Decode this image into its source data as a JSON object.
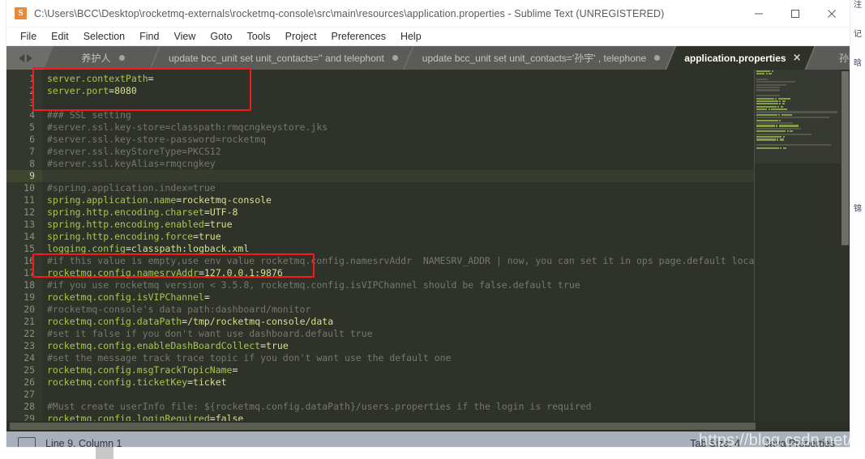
{
  "window": {
    "title": "C:\\Users\\BCC\\Desktop\\rocketmq-externals\\rocketmq-console\\src\\main\\resources\\application.properties - Sublime Text (UNREGISTERED)",
    "app_icon_glyph": "S",
    "controls": {
      "minimize": "minimize-icon",
      "maximize": "maximize-icon",
      "close": "close-icon"
    }
  },
  "menubar": {
    "items": [
      {
        "label": "File"
      },
      {
        "label": "Edit"
      },
      {
        "label": "Selection"
      },
      {
        "label": "Find"
      },
      {
        "label": "View"
      },
      {
        "label": "Goto"
      },
      {
        "label": "Tools"
      },
      {
        "label": "Project"
      },
      {
        "label": "Preferences"
      },
      {
        "label": "Help"
      }
    ]
  },
  "tabs": {
    "items": [
      {
        "label": "养护人",
        "active": false,
        "dirty": true
      },
      {
        "label": "update bcc_unit set unit_contacts='' and telephont",
        "active": false,
        "dirty": true
      },
      {
        "label": "update bcc_unit set unit_contacts='孙宇' , telephone",
        "active": false,
        "dirty": true
      },
      {
        "label": "application.properties",
        "active": true,
        "dirty": false
      },
      {
        "label": "孙宇",
        "active": false,
        "dirty": true
      }
    ],
    "close_glyph": "×",
    "dropdown": "tab-overflow-caret-icon"
  },
  "editor": {
    "current_line": 9,
    "lines": [
      {
        "n": 1,
        "tokens": [
          {
            "t": "server.contextPath",
            "c": "k"
          },
          {
            "t": "=",
            "c": "op"
          }
        ]
      },
      {
        "n": 2,
        "tokens": [
          {
            "t": "server.port",
            "c": "k"
          },
          {
            "t": "=",
            "c": "op"
          },
          {
            "t": "8080",
            "c": "v"
          }
        ]
      },
      {
        "n": 3,
        "tokens": []
      },
      {
        "n": 4,
        "tokens": [
          {
            "t": "### SSL setting",
            "c": "cm"
          }
        ]
      },
      {
        "n": 5,
        "tokens": [
          {
            "t": "#server.ssl.key-store=classpath:rmqcngkeystore.jks",
            "c": "cm"
          }
        ]
      },
      {
        "n": 6,
        "tokens": [
          {
            "t": "#server.ssl.key-store-password=rocketmq",
            "c": "cm"
          }
        ]
      },
      {
        "n": 7,
        "tokens": [
          {
            "t": "#server.ssl.keyStoreType=PKCS12",
            "c": "cm"
          }
        ]
      },
      {
        "n": 8,
        "tokens": [
          {
            "t": "#server.ssl.keyAlias=rmqcngkey",
            "c": "cm"
          }
        ]
      },
      {
        "n": 9,
        "tokens": []
      },
      {
        "n": 10,
        "tokens": [
          {
            "t": "#spring.application.index=true",
            "c": "cm"
          }
        ]
      },
      {
        "n": 11,
        "tokens": [
          {
            "t": "spring.application.name",
            "c": "k"
          },
          {
            "t": "=",
            "c": "op"
          },
          {
            "t": "rocketmq-console",
            "c": "v"
          }
        ]
      },
      {
        "n": 12,
        "tokens": [
          {
            "t": "spring.http.encoding.charset",
            "c": "k"
          },
          {
            "t": "=",
            "c": "op"
          },
          {
            "t": "UTF-8",
            "c": "v"
          }
        ]
      },
      {
        "n": 13,
        "tokens": [
          {
            "t": "spring.http.encoding.enabled",
            "c": "k"
          },
          {
            "t": "=",
            "c": "op"
          },
          {
            "t": "true",
            "c": "v"
          }
        ]
      },
      {
        "n": 14,
        "tokens": [
          {
            "t": "spring.http.encoding.force",
            "c": "k"
          },
          {
            "t": "=",
            "c": "op"
          },
          {
            "t": "true",
            "c": "v"
          }
        ]
      },
      {
        "n": 15,
        "tokens": [
          {
            "t": "logging.config",
            "c": "k"
          },
          {
            "t": "=",
            "c": "op"
          },
          {
            "t": "classpath:logback.xml",
            "c": "v"
          }
        ]
      },
      {
        "n": 16,
        "tokens": [
          {
            "t": "#if this value is empty,use env value rocketmq.config.namesrvAddr  NAMESRV_ADDR | now, you can set it in ops page.default localhost:",
            "c": "cm"
          }
        ]
      },
      {
        "n": 17,
        "tokens": [
          {
            "t": "rocketmq.config.namesrvAddr",
            "c": "k"
          },
          {
            "t": "=",
            "c": "op"
          },
          {
            "t": "127.0.0.1:9876",
            "c": "v"
          }
        ]
      },
      {
        "n": 18,
        "tokens": [
          {
            "t": "#if you use rocketmq version < 3.5.8, rocketmq.config.isVIPChannel should be false.default true",
            "c": "cm"
          }
        ]
      },
      {
        "n": 19,
        "tokens": [
          {
            "t": "rocketmq.config.isVIPChannel",
            "c": "k"
          },
          {
            "t": "=",
            "c": "op"
          }
        ]
      },
      {
        "n": 20,
        "tokens": [
          {
            "t": "#rocketmq-console's data path:dashboard/monitor",
            "c": "cm"
          }
        ]
      },
      {
        "n": 21,
        "tokens": [
          {
            "t": "rocketmq.config.dataPath",
            "c": "k"
          },
          {
            "t": "=",
            "c": "op"
          },
          {
            "t": "/tmp/rocketmq-console/data",
            "c": "v"
          }
        ]
      },
      {
        "n": 22,
        "tokens": [
          {
            "t": "#set it false if you don't want use dashboard.default true",
            "c": "cm"
          }
        ]
      },
      {
        "n": 23,
        "tokens": [
          {
            "t": "rocketmq.config.enableDashBoardCollect",
            "c": "k"
          },
          {
            "t": "=",
            "c": "op"
          },
          {
            "t": "true",
            "c": "v"
          }
        ]
      },
      {
        "n": 24,
        "tokens": [
          {
            "t": "#set the message track trace topic if you don't want use the default one",
            "c": "cm"
          }
        ]
      },
      {
        "n": 25,
        "tokens": [
          {
            "t": "rocketmq.config.msgTrackTopicName",
            "c": "k"
          },
          {
            "t": "=",
            "c": "op"
          }
        ]
      },
      {
        "n": 26,
        "tokens": [
          {
            "t": "rocketmq.config.ticketKey",
            "c": "k"
          },
          {
            "t": "=",
            "c": "op"
          },
          {
            "t": "ticket",
            "c": "v"
          }
        ]
      },
      {
        "n": 27,
        "tokens": []
      },
      {
        "n": 28,
        "tokens": [
          {
            "t": "#Must create userInfo file: ${rocketmq.config.dataPath}/users.properties if the login is required",
            "c": "cm"
          }
        ]
      },
      {
        "n": 29,
        "tokens": [
          {
            "t": "rocketmq.config.loginRequired",
            "c": "k"
          },
          {
            "t": "=",
            "c": "op"
          },
          {
            "t": "false",
            "c": "v"
          }
        ]
      }
    ]
  },
  "statusbar": {
    "icon": "monitor-icon",
    "position": "Line 9, Column 1",
    "tab_size": "Tab Size: 4",
    "syntax": "Java Properties"
  },
  "annotations": {
    "watermark": "https://blog.csdn.net/Mrkaizi",
    "boxes": [
      {
        "name": "server-port-highlight"
      },
      {
        "name": "namesrvaddr-highlight"
      }
    ]
  },
  "background": {
    "right_column_glyphs": [
      "注",
      "记",
      "晗",
      "",
      "",
      "",
      "",
      "锦",
      "",
      "",
      "",
      "",
      "",
      "",
      ""
    ]
  },
  "colors": {
    "editor_bg": "#2e3229",
    "gutter_bg": "#33372e",
    "key": "#a6c84f",
    "value": "#d7e08a",
    "comment": "#76786c",
    "accent_red": "#f51b1b",
    "tabbar_bg": "#6d6d6a",
    "statusbar_bg": "#a8b0bb"
  }
}
